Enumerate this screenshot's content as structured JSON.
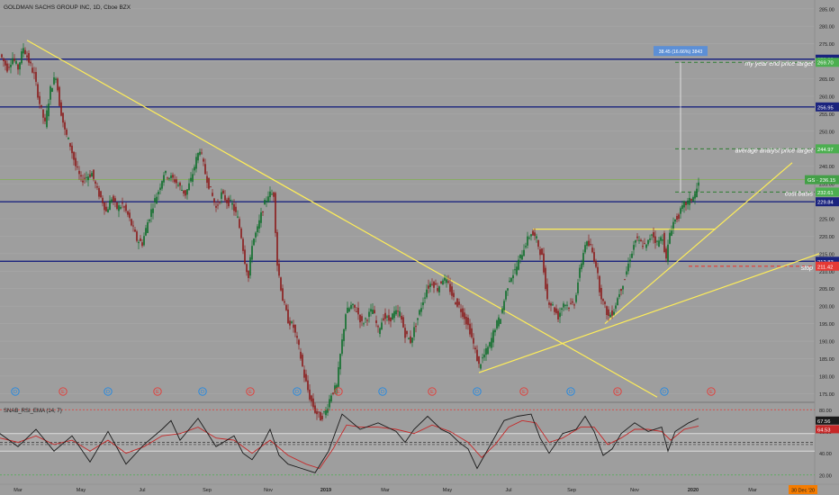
{
  "chart_data": [
    {
      "type": "candlestick",
      "title": "GOLDMAN SACHS GROUP INC, 1D, Cboe BZX",
      "y_ticks": [
        175,
        180,
        185,
        190,
        195,
        200,
        205,
        210,
        215,
        220,
        225,
        230,
        235,
        240,
        245,
        250,
        255,
        260,
        265,
        270,
        275,
        280,
        285
      ],
      "x_ticks": [
        "Mar",
        "May",
        "Jul",
        "Sep",
        "Nov",
        "2019",
        "Mar",
        "May",
        "Jul",
        "Sep",
        "Nov",
        "2020",
        "Mar"
      ],
      "x_range_note": "Mar 2018 – Mar 2020",
      "ylim": [
        172,
        287
      ],
      "close_series": [
        [
          0,
          272
        ],
        [
          4,
          270
        ],
        [
          8,
          268
        ],
        [
          14,
          271
        ],
        [
          20,
          268
        ],
        [
          26,
          274
        ],
        [
          32,
          270
        ],
        [
          38,
          266
        ],
        [
          44,
          258
        ],
        [
          50,
          252
        ],
        [
          56,
          262
        ],
        [
          62,
          266
        ],
        [
          66,
          258
        ],
        [
          72,
          250
        ],
        [
          78,
          246
        ],
        [
          84,
          240
        ],
        [
          90,
          236
        ],
        [
          96,
          237
        ],
        [
          102,
          238
        ],
        [
          108,
          233
        ],
        [
          114,
          230
        ],
        [
          118,
          227
        ],
        [
          124,
          231
        ],
        [
          130,
          228
        ],
        [
          136,
          229
        ],
        [
          142,
          226
        ],
        [
          148,
          222
        ],
        [
          152,
          219
        ],
        [
          158,
          218
        ],
        [
          164,
          224
        ],
        [
          170,
          229
        ],
        [
          176,
          233
        ],
        [
          182,
          238
        ],
        [
          188,
          237
        ],
        [
          194,
          236
        ],
        [
          200,
          234
        ],
        [
          206,
          232
        ],
        [
          212,
          236
        ],
        [
          218,
          242
        ],
        [
          222,
          245
        ],
        [
          228,
          238
        ],
        [
          234,
          233
        ],
        [
          240,
          228
        ],
        [
          246,
          232
        ],
        [
          252,
          230
        ],
        [
          258,
          229
        ],
        [
          264,
          225
        ],
        [
          268,
          220
        ],
        [
          272,
          213
        ],
        [
          276,
          208
        ],
        [
          280,
          218
        ],
        [
          286,
          222
        ],
        [
          292,
          228
        ],
        [
          298,
          232
        ],
        [
          304,
          232
        ],
        [
          308,
          212
        ],
        [
          314,
          202
        ],
        [
          320,
          196
        ],
        [
          326,
          194
        ],
        [
          332,
          188
        ],
        [
          338,
          180
        ],
        [
          344,
          174
        ],
        [
          350,
          170
        ],
        [
          356,
          168
        ],
        [
          362,
          170
        ],
        [
          368,
          175
        ],
        [
          374,
          177
        ],
        [
          378,
          186
        ],
        [
          384,
          198
        ],
        [
          390,
          200
        ],
        [
          396,
          199
        ],
        [
          402,
          195
        ],
        [
          408,
          197
        ],
        [
          414,
          199
        ],
        [
          420,
          193
        ],
        [
          426,
          197
        ],
        [
          432,
          196
        ],
        [
          438,
          198
        ],
        [
          444,
          198
        ],
        [
          450,
          192
        ],
        [
          456,
          190
        ],
        [
          462,
          195
        ],
        [
          468,
          200
        ],
        [
          474,
          205
        ],
        [
          480,
          207
        ],
        [
          486,
          205
        ],
        [
          492,
          208
        ],
        [
          498,
          206
        ],
        [
          504,
          202
        ],
        [
          510,
          200
        ],
        [
          516,
          197
        ],
        [
          522,
          193
        ],
        [
          528,
          187
        ],
        [
          532,
          183
        ],
        [
          538,
          186
        ],
        [
          544,
          189
        ],
        [
          550,
          194
        ],
        [
          556,
          197
        ],
        [
          562,
          204
        ],
        [
          566,
          208
        ],
        [
          572,
          210
        ],
        [
          578,
          214
        ],
        [
          584,
          218
        ],
        [
          590,
          221
        ],
        [
          596,
          219
        ],
        [
          602,
          214
        ],
        [
          608,
          202
        ],
        [
          614,
          200
        ],
        [
          620,
          197
        ],
        [
          626,
          201
        ],
        [
          632,
          200
        ],
        [
          638,
          201
        ],
        [
          644,
          210
        ],
        [
          650,
          218
        ],
        [
          656,
          217
        ],
        [
          662,
          212
        ],
        [
          666,
          205
        ],
        [
          670,
          201
        ],
        [
          676,
          197
        ],
        [
          682,
          199
        ],
        [
          688,
          204
        ],
        [
          694,
          208
        ],
        [
          700,
          214
        ],
        [
          706,
          219
        ],
        [
          712,
          218
        ],
        [
          718,
          217
        ],
        [
          724,
          221
        ],
        [
          730,
          218
        ],
        [
          736,
          220
        ],
        [
          740,
          213
        ],
        [
          744,
          221
        ],
        [
          748,
          224
        ],
        [
          754,
          226
        ],
        [
          760,
          229
        ],
        [
          766,
          230
        ],
        [
          772,
          232
        ],
        [
          776,
          235
        ]
      ],
      "series": [
        {
          "name": "GS",
          "last": "236.15"
        }
      ],
      "horizontal_levels": [
        {
          "value": 270.6,
          "label": "270.60",
          "kind": "blue-line"
        },
        {
          "value": 256.95,
          "label": "256.95",
          "kind": "blue-line"
        },
        {
          "value": 229.84,
          "label": "229.84",
          "kind": "blue-line"
        },
        {
          "value": 212.83,
          "label": "212.83",
          "kind": "blue-line"
        },
        {
          "value": 269.7,
          "label": "269.70",
          "kind": "green-dashed"
        },
        {
          "value": 244.97,
          "label": "244.97",
          "kind": "green-dashed"
        },
        {
          "value": 232.61,
          "label": "232.61",
          "kind": "green-dashed"
        },
        {
          "value": 211.42,
          "label": "211.42",
          "kind": "red-dashed"
        }
      ],
      "annotations": [
        {
          "text": "my year end price target",
          "value": 269.7
        },
        {
          "text": "average analyst price target",
          "value": 244.97
        },
        {
          "text": "cost basis",
          "value": 232.61
        },
        {
          "text": "stop",
          "value": 211.42
        },
        {
          "text": "38.45 (16.66%) 3843",
          "kind": "measure"
        }
      ],
      "event_markers": [
        "D",
        "E",
        "D",
        "E",
        "D",
        "E",
        "D",
        "E",
        "D",
        "E",
        "D",
        "E",
        "D",
        "E",
        "D",
        "E"
      ]
    },
    {
      "type": "line",
      "title": "SNAB_RSI_EMA (14, 7)",
      "y_ticks": [
        20,
        40,
        60,
        80
      ],
      "ylim": [
        14,
        86
      ],
      "reference_levels": [
        80,
        50,
        48,
        20
      ],
      "series": [
        {
          "name": "RSI",
          "last": "67.56",
          "color": "#1a1a1a"
        },
        {
          "name": "EMA",
          "last": "64.53",
          "color": "#c62828"
        }
      ],
      "values_rsi": [
        [
          0,
          58
        ],
        [
          20,
          46
        ],
        [
          40,
          62
        ],
        [
          60,
          42
        ],
        [
          80,
          56
        ],
        [
          100,
          32
        ],
        [
          120,
          60
        ],
        [
          140,
          30
        ],
        [
          160,
          48
        ],
        [
          180,
          62
        ],
        [
          190,
          70
        ],
        [
          200,
          52
        ],
        [
          220,
          72
        ],
        [
          240,
          46
        ],
        [
          260,
          56
        ],
        [
          270,
          40
        ],
        [
          280,
          34
        ],
        [
          290,
          46
        ],
        [
          300,
          62
        ],
        [
          310,
          38
        ],
        [
          320,
          30
        ],
        [
          335,
          26
        ],
        [
          350,
          22
        ],
        [
          365,
          42
        ],
        [
          380,
          76
        ],
        [
          400,
          62
        ],
        [
          420,
          68
        ],
        [
          440,
          60
        ],
        [
          450,
          50
        ],
        [
          460,
          62
        ],
        [
          475,
          74
        ],
        [
          490,
          62
        ],
        [
          500,
          58
        ],
        [
          510,
          50
        ],
        [
          520,
          44
        ],
        [
          530,
          26
        ],
        [
          545,
          48
        ],
        [
          560,
          70
        ],
        [
          575,
          74
        ],
        [
          590,
          76
        ],
        [
          600,
          54
        ],
        [
          610,
          40
        ],
        [
          625,
          58
        ],
        [
          640,
          62
        ],
        [
          650,
          74
        ],
        [
          660,
          60
        ],
        [
          670,
          38
        ],
        [
          680,
          44
        ],
        [
          690,
          58
        ],
        [
          705,
          68
        ],
        [
          720,
          60
        ],
        [
          735,
          64
        ],
        [
          742,
          42
        ],
        [
          750,
          60
        ],
        [
          765,
          68
        ],
        [
          776,
          72
        ]
      ],
      "values_ema": [
        [
          0,
          54
        ],
        [
          20,
          50
        ],
        [
          40,
          56
        ],
        [
          60,
          48
        ],
        [
          80,
          52
        ],
        [
          100,
          42
        ],
        [
          120,
          52
        ],
        [
          140,
          40
        ],
        [
          160,
          46
        ],
        [
          180,
          56
        ],
        [
          200,
          58
        ],
        [
          220,
          64
        ],
        [
          240,
          54
        ],
        [
          260,
          52
        ],
        [
          280,
          40
        ],
        [
          300,
          52
        ],
        [
          320,
          38
        ],
        [
          340,
          30
        ],
        [
          355,
          26
        ],
        [
          370,
          44
        ],
        [
          385,
          66
        ],
        [
          400,
          64
        ],
        [
          420,
          64
        ],
        [
          440,
          62
        ],
        [
          460,
          58
        ],
        [
          480,
          66
        ],
        [
          500,
          60
        ],
        [
          520,
          50
        ],
        [
          535,
          36
        ],
        [
          550,
          48
        ],
        [
          565,
          64
        ],
        [
          580,
          70
        ],
        [
          595,
          68
        ],
        [
          610,
          50
        ],
        [
          625,
          54
        ],
        [
          645,
          64
        ],
        [
          660,
          64
        ],
        [
          675,
          48
        ],
        [
          690,
          54
        ],
        [
          705,
          62
        ],
        [
          720,
          62
        ],
        [
          735,
          60
        ],
        [
          745,
          52
        ],
        [
          760,
          62
        ],
        [
          776,
          65
        ]
      ]
    }
  ],
  "footer": {
    "date_badge": "30 Dec '20"
  },
  "colors": {
    "background": "#9e9e9e",
    "level_line": "#1a237e",
    "trend_line": "#ffee58",
    "target_dash": "#2e7d32",
    "stop_dash": "#e53935",
    "axis_text": "#212121"
  }
}
